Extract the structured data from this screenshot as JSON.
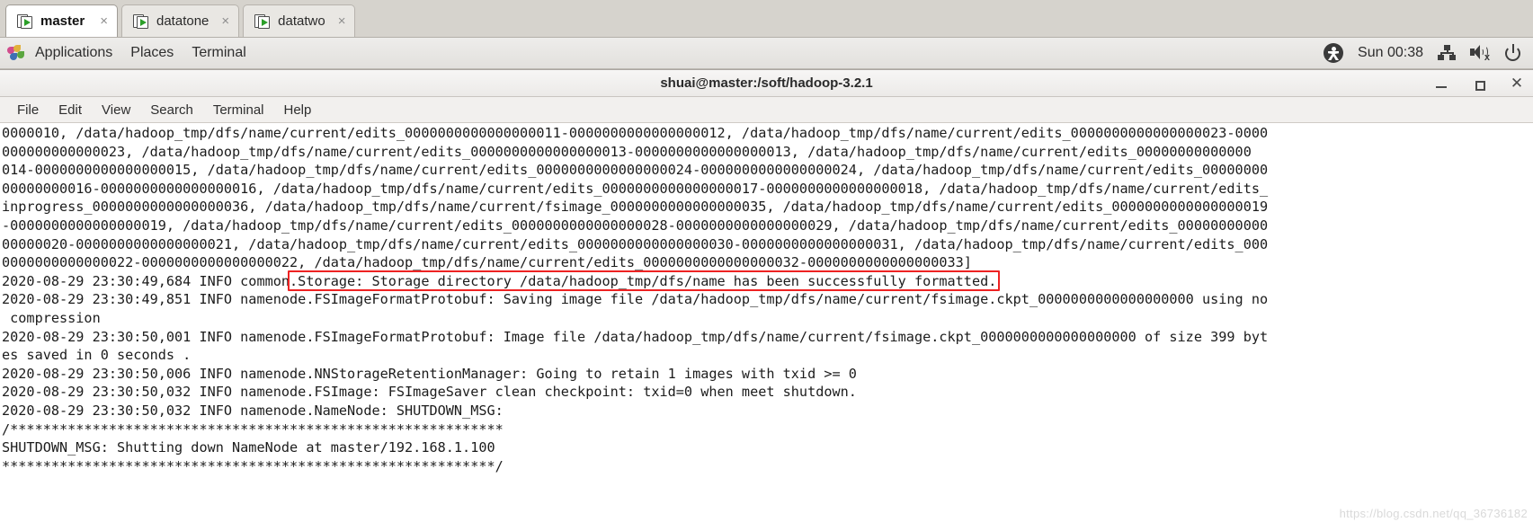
{
  "tabs": [
    {
      "label": "master",
      "icon": "terminal-window-icon",
      "close": "×",
      "active": true
    },
    {
      "label": "datatone",
      "icon": "terminal-window-icon",
      "close": "×",
      "active": false
    },
    {
      "label": "datatwo",
      "icon": "terminal-window-icon",
      "close": "×",
      "active": false
    }
  ],
  "panel": {
    "applications": "Applications",
    "places": "Places",
    "terminal": "Terminal",
    "clock": "Sun 00:38",
    "icons": {
      "foot": "gnome-foot-logo",
      "accessibility": "accessibility-icon",
      "network": "network-icon",
      "volume": "volume-muted-icon",
      "power": "power-icon"
    }
  },
  "window": {
    "title": "shuai@master:/soft/hadoop-3.2.1",
    "minimize": "–",
    "maximize": "□",
    "close": "✕"
  },
  "menubar": [
    "File",
    "Edit",
    "View",
    "Search",
    "Terminal",
    "Help"
  ],
  "terminal": {
    "lines": [
      "0000010, /data/hadoop_tmp/dfs/name/current/edits_0000000000000000011-0000000000000000012, /data/hadoop_tmp/dfs/name/current/edits_0000000000000000023-0000",
      "000000000000023, /data/hadoop_tmp/dfs/name/current/edits_0000000000000000013-0000000000000000013, /data/hadoop_tmp/dfs/name/current/edits_00000000000000",
      "014-0000000000000000015, /data/hadoop_tmp/dfs/name/current/edits_0000000000000000024-0000000000000000024, /data/hadoop_tmp/dfs/name/current/edits_00000000",
      "00000000016-0000000000000000016, /data/hadoop_tmp/dfs/name/current/edits_0000000000000000017-0000000000000000018, /data/hadoop_tmp/dfs/name/current/edits_",
      "inprogress_0000000000000000036, /data/hadoop_tmp/dfs/name/current/fsimage_0000000000000000035, /data/hadoop_tmp/dfs/name/current/edits_0000000000000000019",
      "-0000000000000000019, /data/hadoop_tmp/dfs/name/current/edits_0000000000000000028-0000000000000000029, /data/hadoop_tmp/dfs/name/current/edits_00000000000",
      "00000020-0000000000000000021, /data/hadoop_tmp/dfs/name/current/edits_0000000000000000030-0000000000000000031, /data/hadoop_tmp/dfs/name/current/edits_000",
      "0000000000000022-0000000000000000022, /data/hadoop_tmp/dfs/name/current/edits_0000000000000000032-0000000000000000033]",
      "2020-08-29 23:30:49,684 INFO common.Storage: Storage directory /data/hadoop_tmp/dfs/name has been successfully formatted.",
      "2020-08-29 23:30:49,851 INFO namenode.FSImageFormatProtobuf: Saving image file /data/hadoop_tmp/dfs/name/current/fsimage.ckpt_0000000000000000000 using no",
      " compression",
      "2020-08-29 23:30:50,001 INFO namenode.FSImageFormatProtobuf: Image file /data/hadoop_tmp/dfs/name/current/fsimage.ckpt_0000000000000000000 of size 399 byt",
      "es saved in 0 seconds .",
      "2020-08-29 23:30:50,006 INFO namenode.NNStorageRetentionManager: Going to retain 1 images with txid >= 0",
      "2020-08-29 23:30:50,032 INFO namenode.FSImage: FSImageSaver clean checkpoint: txid=0 when meet shutdown.",
      "2020-08-29 23:30:50,032 INFO namenode.NameNode: SHUTDOWN_MSG:",
      "/************************************************************",
      "SHUTDOWN_MSG: Shutting down NameNode at master/192.168.1.100",
      "************************************************************/"
    ],
    "highlight": {
      "text": ".Storage: Storage directory /data/hadoop_tmp/dfs/name has been successfully formatted.",
      "color": "#ee2222"
    },
    "watermark": "https://blog.csdn.net/qq_36736182"
  }
}
